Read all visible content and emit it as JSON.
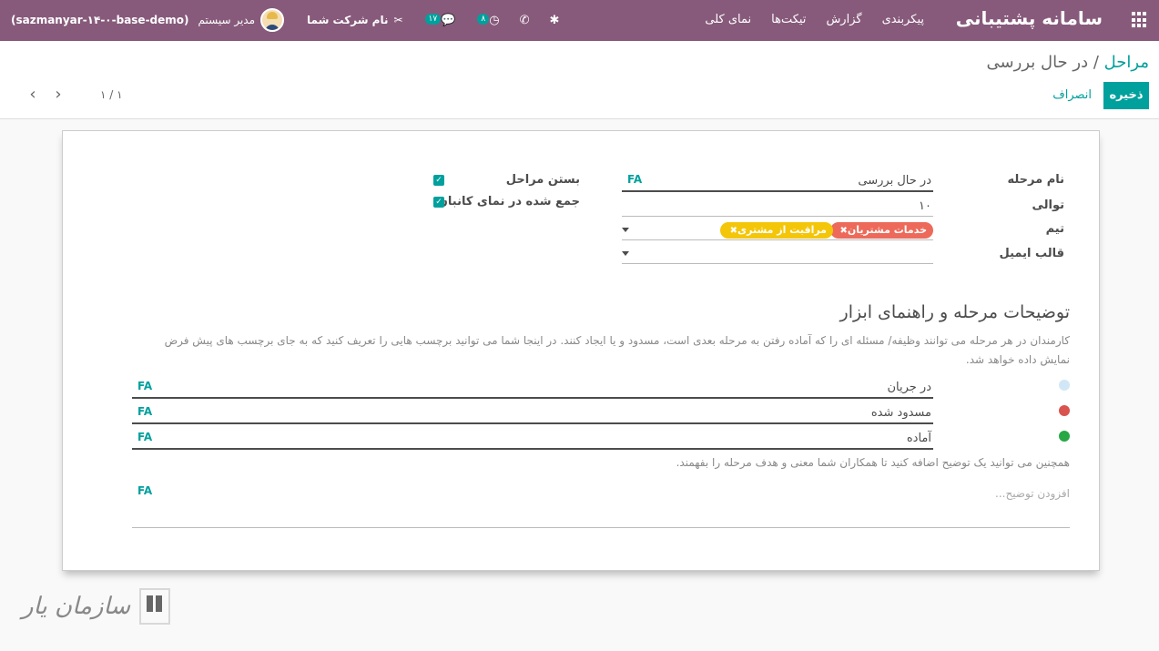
{
  "navbar": {
    "brand": "سامانه پشتیبانی",
    "menu": [
      "نمای کلی",
      "تیکت‌ها",
      "گزارش",
      "پیکربندی"
    ],
    "company": "نام شرکت شما",
    "user": "مدیر سیستم",
    "database": "(sazmanyar-۱۴-۰-base-demo)",
    "activity_count": "۸",
    "message_count": "۱۷",
    "accent": "#875a7b"
  },
  "control": {
    "breadcrumb_parent": "مراحل",
    "breadcrumb_sep": "/",
    "breadcrumb_current": "در حال بررسی",
    "save_label": "ذخیره",
    "discard_label": "انصراف",
    "pager_value": "۱ / ۱"
  },
  "form": {
    "stage_name_label": "نام مرحله",
    "stage_name_value": "در حال بررسی",
    "sequence_label": "توالی",
    "sequence_value": "۱۰",
    "team_label": "تیم",
    "teams": [
      {
        "name": "خدمات مشتریان",
        "color": "#ed6a5a"
      },
      {
        "name": "مراقبت از مشتری",
        "color": "#f4c609"
      }
    ],
    "email_template_label": "قالب ایمیل",
    "email_template_value": "",
    "folded_label": "بستن مراحل",
    "folded_checked": true,
    "kanban_label": "جمع شده در نمای کانبان",
    "kanban_checked": true,
    "lang_tag": "FA",
    "section_title": "توضیحات مرحله و راهنمای ابزار",
    "section_help": "کارمندان در هر مرحله می توانند وظیفه/ مسئله ای را که آماده رفتن به مرحله بعدی است، مسدود و یا ایجاد کنند. در اینجا شما می توانید برچسب هایی را تعریف کنید که به جای برچسب های پیش فرض نمایش داده خواهد شد.",
    "kanban_states": [
      {
        "label": "در جریان",
        "color": "#d1e7f7"
      },
      {
        "label": "مسدود شده",
        "color": "#d9534f"
      },
      {
        "label": "آماده",
        "color": "#28a745"
      }
    ],
    "description_help": "همچنین می توانید یک توضیح اضافه کنید تا همکاران شما معنی و هدف مرحله را بفهمند.",
    "description_placeholder": "افزودن توضیح..."
  },
  "watermark": {
    "text": "سازمان یار"
  }
}
